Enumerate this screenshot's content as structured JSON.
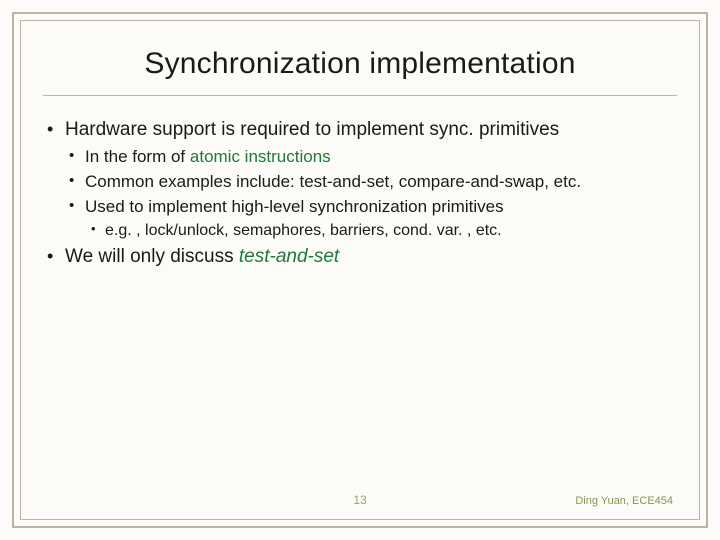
{
  "title": "Synchronization implementation",
  "b1": "Hardware support is required to implement sync. primitives",
  "b1_1a": "In the form of ",
  "b1_1b": "atomic instructions",
  "b1_2": "Common examples include: test-and-set, compare-and-swap, etc.",
  "b1_3": "Used to implement high-level synchronization primitives",
  "b1_3_1": "e.g. , lock/unlock, semaphores, barriers, cond. var. , etc.",
  "b2a": "We will only discuss ",
  "b2b": "test-and-set",
  "page": "13",
  "author": "Ding Yuan, ECE454"
}
